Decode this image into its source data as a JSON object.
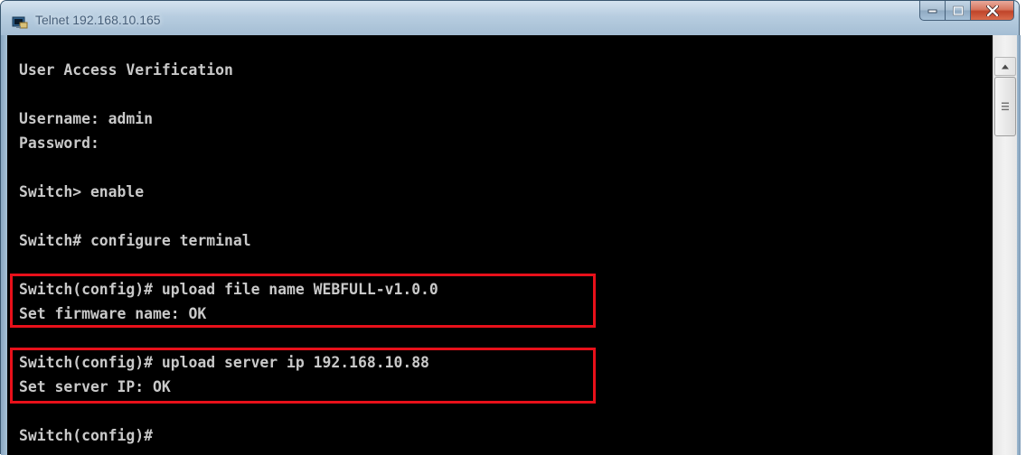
{
  "window": {
    "title": "Telnet 192.168.10.165"
  },
  "icons": {
    "app": "telnet-app-icon",
    "minimize": "minimize-icon",
    "maximize": "maximize-icon",
    "close": "close-icon",
    "scroll_up": "scroll-up-arrow-icon",
    "thumb_grip": "grip-icon"
  },
  "colors": {
    "terminal_bg": "#000000",
    "terminal_text": "#c9c9c9",
    "highlight_box": "#e8101a"
  },
  "terminal": {
    "lines": [
      "User Access Verification",
      "",
      "Username: admin",
      "Password:",
      "",
      "Switch> enable",
      "",
      "Switch# configure terminal",
      "",
      "Switch(config)# upload file name WEBFULL-v1.0.0",
      "Set firmware name: OK",
      "",
      "Switch(config)# upload server ip 192.168.10.88",
      "Set server IP: OK",
      "",
      "Switch(config)#"
    ]
  }
}
